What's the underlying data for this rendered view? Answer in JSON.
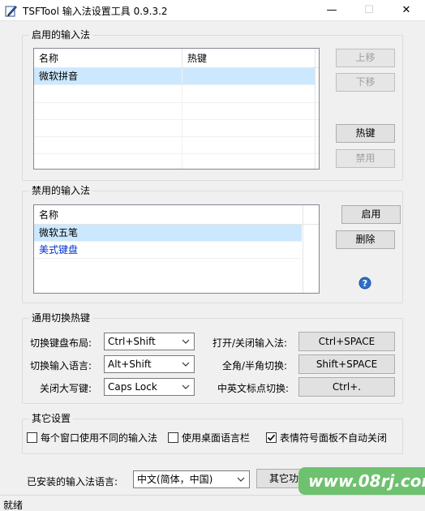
{
  "window": {
    "title": "TSFTool 输入法设置工具 0.9.3.2",
    "minimize_glyph": "—",
    "maximize_glyph": "☐",
    "close_glyph": "✕"
  },
  "enabled_group": {
    "legend": "启用的输入法",
    "columns": [
      "名称",
      "热键"
    ],
    "rows": [
      {
        "name": "微软拼音",
        "hotkey": ""
      }
    ],
    "buttons": {
      "move_up": "上移",
      "move_down": "下移",
      "hotkey": "热键",
      "disable": "禁用"
    }
  },
  "disabled_group": {
    "legend": "禁用的输入法",
    "columns": [
      "名称"
    ],
    "rows": [
      {
        "name": "微软五笔"
      },
      {
        "name": "美式键盘"
      }
    ],
    "buttons": {
      "enable": "启用",
      "delete": "删除"
    },
    "help_icon": "help-icon"
  },
  "hotkeys_group": {
    "legend": "通用切换热键",
    "left": [
      {
        "label": "切换键盘布局:",
        "value": "Ctrl+Shift"
      },
      {
        "label": "切换输入语言:",
        "value": "Alt+Shift"
      },
      {
        "label": "关闭大写键:",
        "value": "Caps Lock"
      }
    ],
    "right": [
      {
        "label": "打开/关闭输入法:",
        "value": "Ctrl+SPACE"
      },
      {
        "label": "全角/半角切换:",
        "value": "Shift+SPACE"
      },
      {
        "label": "中英文标点切换:",
        "value": "Ctrl+."
      }
    ]
  },
  "other_group": {
    "legend": "其它设置",
    "checkboxes": [
      {
        "label": "每个窗口使用不同的输入法",
        "checked": false
      },
      {
        "label": "使用桌面语言栏",
        "checked": false
      },
      {
        "label": "表情符号面板不自动关闭",
        "checked": true
      }
    ]
  },
  "language": {
    "label": "已安装的输入法语言:",
    "value": "中文(简体，中国)",
    "other_button": "其它功能"
  },
  "status": {
    "text": "就绪"
  },
  "watermark": {
    "text": "www.08rj.com",
    "color": "#6ec16e"
  }
}
